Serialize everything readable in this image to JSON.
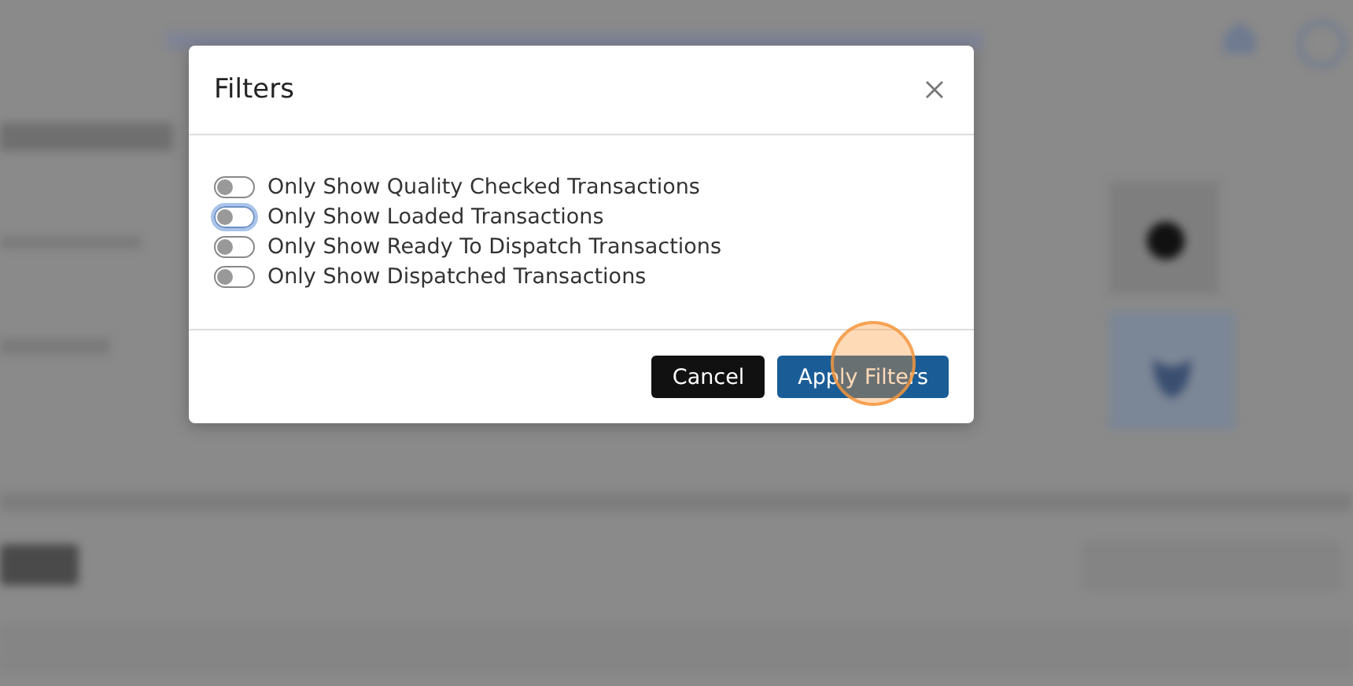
{
  "dialog": {
    "title": "Filters",
    "filters": [
      {
        "label": "Only Show Quality Checked Transactions",
        "on": false,
        "focused": false
      },
      {
        "label": "Only Show Loaded Transactions",
        "on": false,
        "focused": true
      },
      {
        "label": "Only Show Ready To Dispatch Transactions",
        "on": false,
        "focused": false
      },
      {
        "label": "Only Show Dispatched Transactions",
        "on": false,
        "focused": false
      }
    ],
    "buttons": [
      {
        "label": "Cancel",
        "kind": "secondary"
      },
      {
        "label": "Apply Filters",
        "kind": "primary",
        "clicked": true
      }
    ]
  }
}
